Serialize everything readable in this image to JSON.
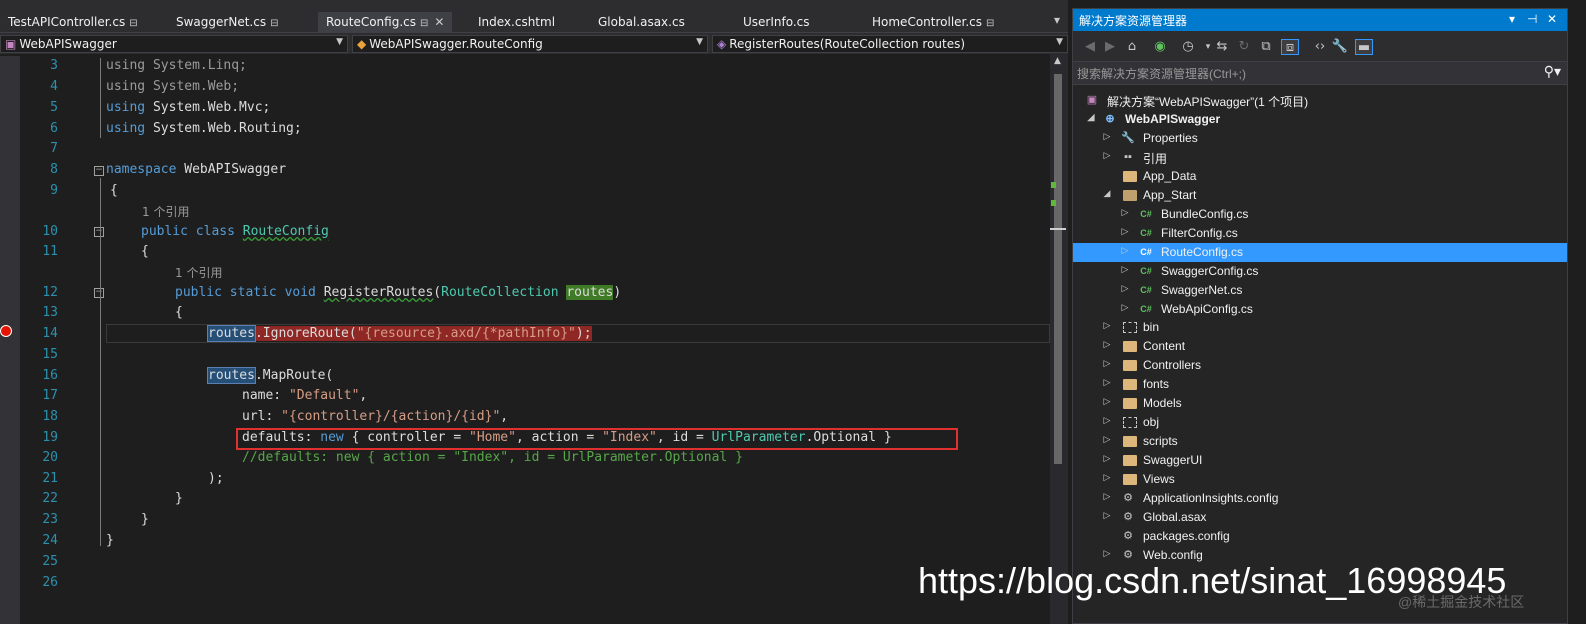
{
  "tabs": [
    {
      "label": "TestAPIController.cs",
      "pin": "⊟"
    },
    {
      "label": "SwaggerNet.cs",
      "pin": "⊟"
    },
    {
      "label": "RouteConfig.cs",
      "pin": "⊟",
      "close": "✕",
      "active": true
    },
    {
      "label": "Index.cshtml"
    },
    {
      "label": "Global.asax.cs"
    },
    {
      "label": "UserInfo.cs"
    },
    {
      "label": "HomeController.cs",
      "pin": "⊟"
    }
  ],
  "nav": {
    "project": "WebAPISwagger",
    "class": "WebAPISwagger.RouteConfig",
    "member": "RegisterRoutes(RouteCollection routes)"
  },
  "code": {
    "line_numbers": [
      "3",
      "4",
      "5",
      "6",
      "7",
      "8",
      "9",
      "10",
      "11",
      "12",
      "13",
      "14",
      "15",
      "16",
      "17",
      "18",
      "19",
      "20",
      "21",
      "22",
      "23",
      "24",
      "25",
      "26"
    ],
    "ref_label": "1 个引用",
    "l3_kw": "using",
    "l3_ns": " System.Linq;",
    "l4_kw": "using",
    "l4_ns": " System.Web;",
    "l5_kw": "using",
    "l5_ns": " System.Web.Mvc;",
    "l6_kw": "using",
    "l6_ns": " System.Web.Routing;",
    "l8_kw": "namespace",
    "l8_name": " WebAPISwagger",
    "l9": "{",
    "l10_kw": "public class",
    "l10_name": "RouteConfig",
    "l11": "{",
    "l12_kw": "public static void",
    "l12_method": "RegisterRoutes",
    "l12_paren": "(",
    "l12_type": "RouteCollection",
    "l12_param": "routes",
    "l12_close": ")",
    "l13": "{",
    "l14_var": "routes",
    "l14_call": ".IgnoreRoute(",
    "l14_str": "\"{resource}.axd/{*pathInfo}\"",
    "l14_end": ");",
    "l16_var": "routes",
    "l16_call": ".MapRoute(",
    "l17_key": "name: ",
    "l17_str": "\"Default\"",
    "l17_end": ",",
    "l18_key": "url: ",
    "l18_str": "\"{controller}/{action}/{id}\"",
    "l18_end": ",",
    "l19_key": "defaults: ",
    "l19_new": "new",
    "l19_a": " { controller = ",
    "l19_s1": "\"Home\"",
    "l19_b": ", action = ",
    "l19_s2": "\"Index\"",
    "l19_c": ", id = ",
    "l19_type": "UrlParameter",
    "l19_d": ".Optional }",
    "l20": "//defaults: new { action = \"Index\", id = UrlParameter.Optional }",
    "l21": ");",
    "l22": "}",
    "l23": "}",
    "l24": "}"
  },
  "solution_explorer": {
    "title": "解决方案资源管理器",
    "title_controls": [
      "▾",
      "⊣",
      "✕"
    ],
    "search_placeholder": "搜索解决方案资源管理器(Ctrl+;)",
    "items": [
      {
        "label": "解决方案“WebAPISwagger”(1 个项目)"
      },
      {
        "label": "WebAPISwagger"
      },
      {
        "label": "Properties"
      },
      {
        "label": "引用"
      },
      {
        "label": "App_Data"
      },
      {
        "label": "App_Start"
      },
      {
        "label": "BundleConfig.cs"
      },
      {
        "label": "FilterConfig.cs"
      },
      {
        "label": "RouteConfig.cs"
      },
      {
        "label": "SwaggerConfig.cs"
      },
      {
        "label": "SwaggerNet.cs"
      },
      {
        "label": "WebApiConfig.cs"
      },
      {
        "label": "bin"
      },
      {
        "label": "Content"
      },
      {
        "label": "Controllers"
      },
      {
        "label": "fonts"
      },
      {
        "label": "Models"
      },
      {
        "label": "obj"
      },
      {
        "label": "scripts"
      },
      {
        "label": "SwaggerUI"
      },
      {
        "label": "Views"
      },
      {
        "label": "ApplicationInsights.config"
      },
      {
        "label": "Global.asax"
      },
      {
        "label": "packages.config"
      },
      {
        "label": "Web.config"
      }
    ]
  },
  "watermark": "https://blog.csdn.net/sinat_16998945",
  "watermark_small": "@稀土掘金技术社区",
  "colors": {
    "accent": "#007acc",
    "selection": "#3399ff",
    "breakpoint": "#e51400",
    "highlight_box": "#e03030"
  }
}
